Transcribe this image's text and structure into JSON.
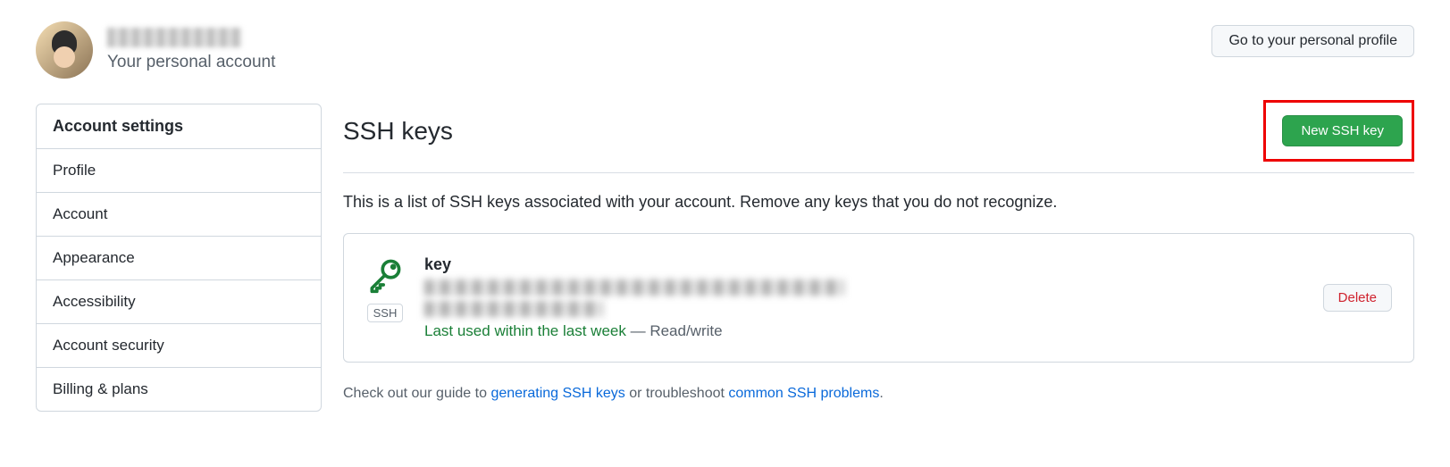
{
  "profile": {
    "subtitle": "Your personal account"
  },
  "top_action": {
    "label": "Go to your personal profile"
  },
  "sidebar": {
    "header": "Account settings",
    "items": [
      {
        "label": "Profile"
      },
      {
        "label": "Account"
      },
      {
        "label": "Appearance"
      },
      {
        "label": "Accessibility"
      },
      {
        "label": "Account security"
      },
      {
        "label": "Billing & plans"
      }
    ]
  },
  "section": {
    "title": "SSH keys",
    "new_btn": "New SSH key",
    "description": "This is a list of SSH keys associated with your account. Remove any keys that you do not recognize."
  },
  "key": {
    "title": "key",
    "badge": "SSH",
    "usage_green": "Last used within the last week",
    "usage_separator": " — ",
    "usage_mode": "Read/write",
    "delete": "Delete"
  },
  "footer": {
    "prefix": "Check out our guide to ",
    "link1": "generating SSH keys",
    "mid": " or troubleshoot ",
    "link2": "common SSH problems",
    "suffix": "."
  }
}
